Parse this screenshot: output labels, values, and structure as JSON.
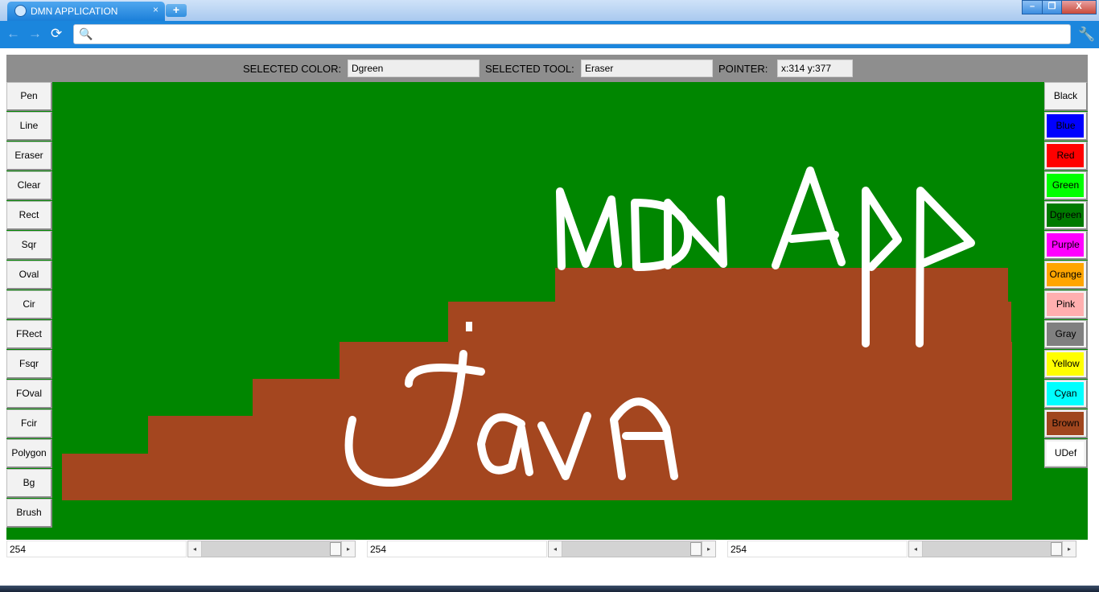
{
  "browser": {
    "tab_title": "DMN APPLICATION",
    "tab_close_glyph": "×",
    "new_tab_glyph": "+",
    "back_glyph": "←",
    "forward_glyph": "→",
    "reload_glyph": "⟳",
    "search_glyph": "🔍",
    "address_value": "",
    "wrench_glyph": "🔧",
    "window_controls": {
      "minimize": "–",
      "maximize": "❐",
      "close": "X"
    }
  },
  "status": {
    "color_label": "SELECTED COLOR:",
    "color_value": "Dgreen",
    "tool_label": "SELECTED TOOL:",
    "tool_value": "Eraser",
    "pointer_label": "POINTER:",
    "pointer_value": "x:314   y:377"
  },
  "tools": [
    "Pen",
    "Line",
    "Eraser",
    "Clear",
    "Rect",
    "Sqr",
    "Oval",
    "Cir",
    "FRect",
    "Fsqr",
    "FOval",
    "Fcir",
    "Polygon",
    "Bg",
    "Brush"
  ],
  "colors": [
    {
      "label": "Black",
      "swatch": "#f2f2f2"
    },
    {
      "label": "Blue",
      "swatch": "#0000ff"
    },
    {
      "label": "Red",
      "swatch": "#ff0000"
    },
    {
      "label": "Green",
      "swatch": "#00ff00"
    },
    {
      "label": "Dgreen",
      "swatch": "#007a00"
    },
    {
      "label": "Purple",
      "swatch": "#ff00ff"
    },
    {
      "label": "Orange",
      "swatch": "#ffa500"
    },
    {
      "label": "Pink",
      "swatch": "#ffafaf"
    },
    {
      "label": "Gray",
      "swatch": "#808080"
    },
    {
      "label": "Yellow",
      "swatch": "#ffff00"
    },
    {
      "label": "Cyan",
      "swatch": "#00ffff"
    },
    {
      "label": "Brown",
      "swatch": "#a0461e"
    },
    {
      "label": "UDef",
      "swatch": "#ffffff"
    }
  ],
  "canvas": {
    "background_color": "#008600",
    "fill_color": "#a4461f",
    "stroke_color": "#ffffff",
    "text_mdn": "MDN App",
    "text_java": "Java"
  },
  "sliders": [
    {
      "value": "254",
      "level": 254,
      "max": 255
    },
    {
      "value": "254",
      "level": 254,
      "max": 255
    },
    {
      "value": "254",
      "level": 254,
      "max": 255
    }
  ],
  "slider_arrows": {
    "left": "◂",
    "right": "▸"
  }
}
